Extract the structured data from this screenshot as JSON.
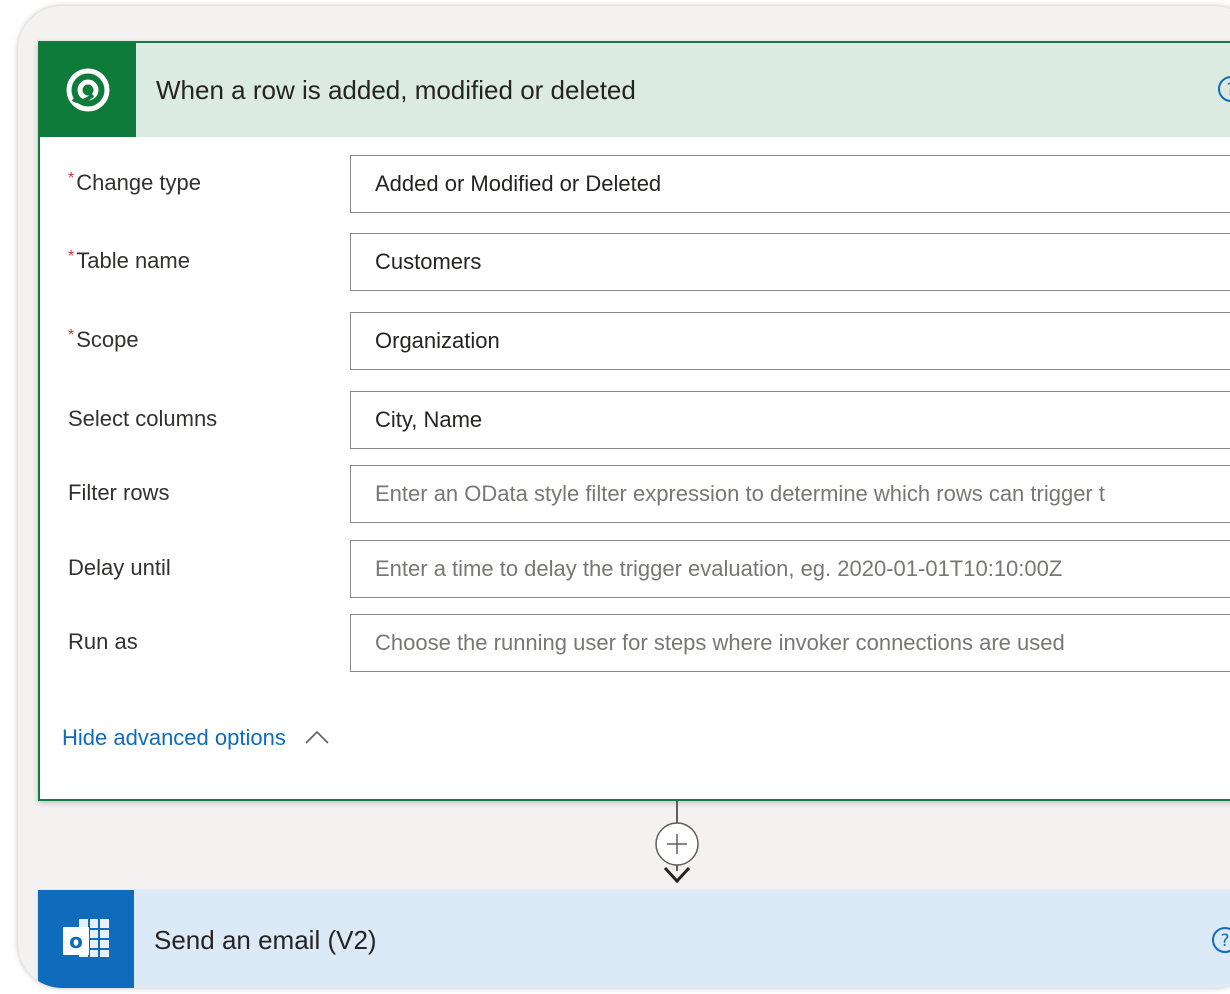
{
  "trigger": {
    "title": "When a row is added, modified or deleted",
    "fields": [
      {
        "label": "Change type",
        "required": true,
        "value": "Added or Modified or Deleted",
        "is_placeholder": false,
        "dropdown": true
      },
      {
        "label": "Table name",
        "required": true,
        "value": "Customers",
        "is_placeholder": false,
        "dropdown": true
      },
      {
        "label": "Scope",
        "required": true,
        "value": "Organization",
        "is_placeholder": false,
        "dropdown": true
      },
      {
        "label": "Select columns",
        "required": false,
        "value": "City, Name",
        "is_placeholder": false,
        "dropdown": false
      },
      {
        "label": "Filter rows",
        "required": false,
        "value": "Enter an OData style filter expression to determine which rows can trigger t",
        "is_placeholder": true,
        "dropdown": false
      },
      {
        "label": "Delay until",
        "required": false,
        "value": "Enter a time to delay the trigger evaluation, eg. 2020-01-01T10:10:00Z",
        "is_placeholder": true,
        "dropdown": false
      },
      {
        "label": "Run as",
        "required": false,
        "value": "Choose the running user for steps where invoker connections are used",
        "is_placeholder": true,
        "dropdown": true
      }
    ],
    "required_marker": "*",
    "hide_advanced_label": "Hide advanced options"
  },
  "action": {
    "title": "Send an email (V2)"
  },
  "colors": {
    "dataverse_green": "#0f7b3b",
    "outlook_blue": "#0f6cbd",
    "link_blue": "#0f6cbd",
    "required_red": "#d13438"
  }
}
